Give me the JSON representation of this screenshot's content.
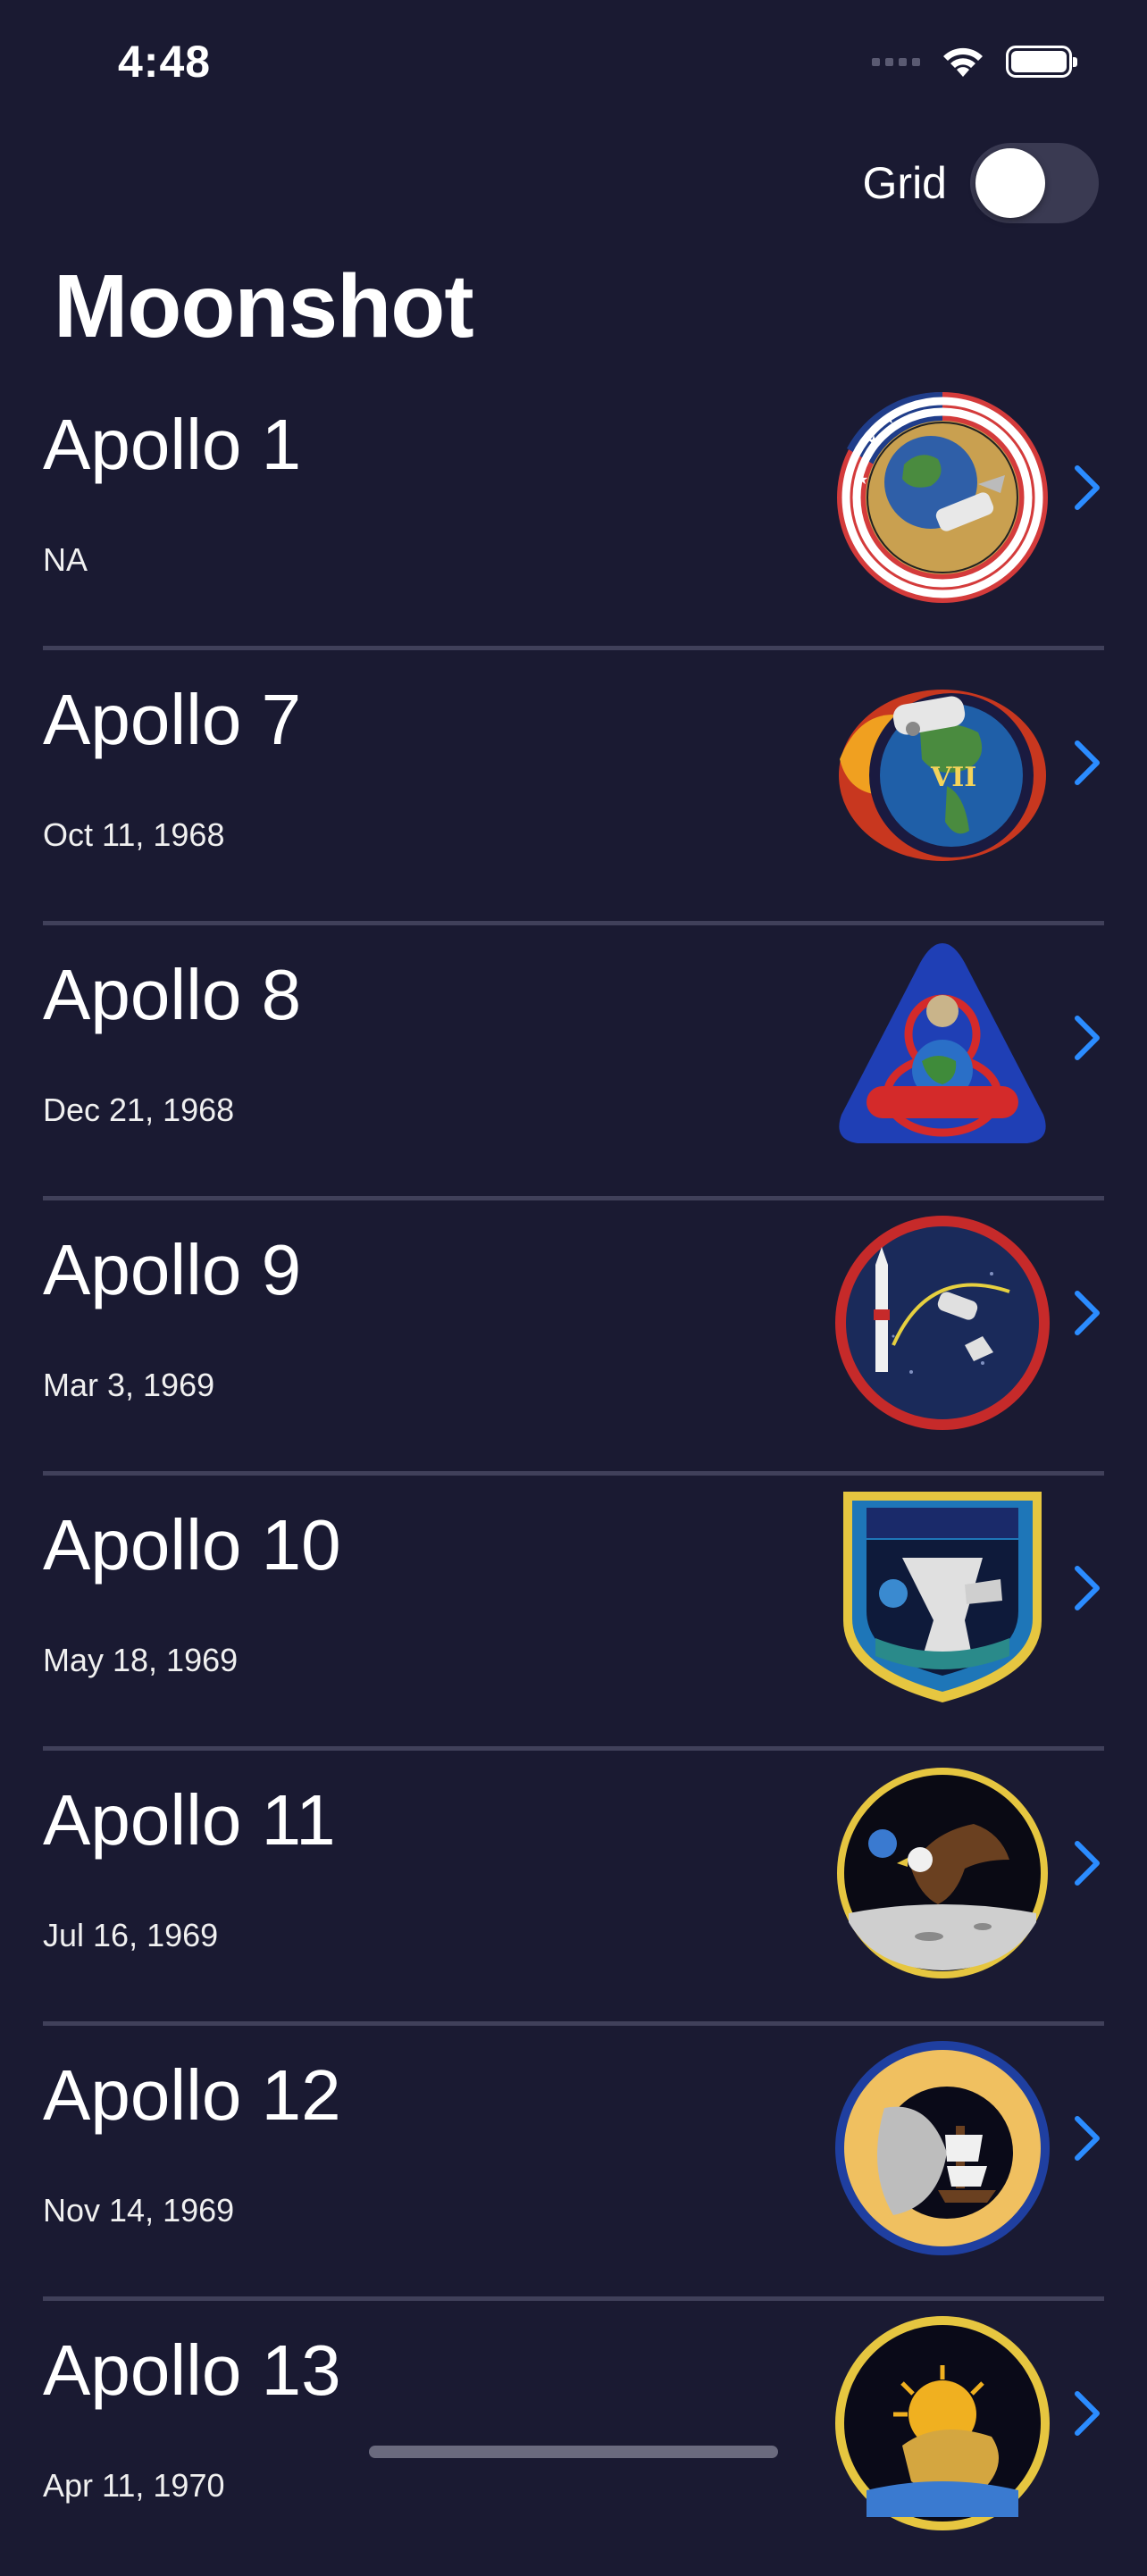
{
  "status_bar": {
    "time": "4:48"
  },
  "header": {
    "grid_label": "Grid",
    "grid_enabled": false,
    "title": "Moonshot"
  },
  "missions": [
    {
      "name": "Apollo 1",
      "date": "NA"
    },
    {
      "name": "Apollo 7",
      "date": "Oct 11, 1968"
    },
    {
      "name": "Apollo 8",
      "date": "Dec 21, 1968"
    },
    {
      "name": "Apollo 9",
      "date": "Mar 3, 1969"
    },
    {
      "name": "Apollo 10",
      "date": "May 18, 1969"
    },
    {
      "name": "Apollo 11",
      "date": "Jul 16, 1969"
    },
    {
      "name": "Apollo 12",
      "date": "Nov 14, 1969"
    },
    {
      "name": "Apollo 13",
      "date": "Apr 11, 1970"
    }
  ],
  "colors": {
    "background": "#1a1a32",
    "accent": "#2b8cff",
    "divider": "#40405a"
  }
}
